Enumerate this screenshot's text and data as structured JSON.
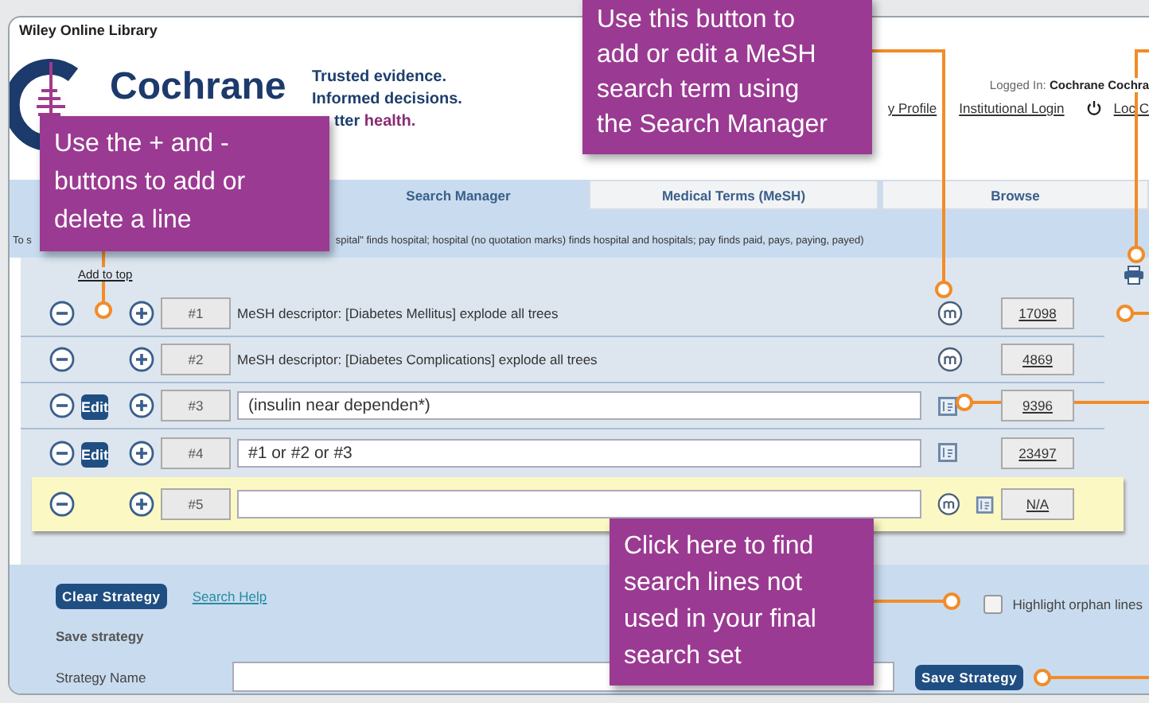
{
  "header": {
    "site_name": "Wiley Online Library",
    "logo_text": "Cochrane",
    "tagline": [
      "Trusted evidence.",
      "Informed decisions."
    ],
    "tagline_last": {
      "text": "tter",
      "accent": "health."
    },
    "logged_in": "Logged In: **Cochrane Cochra**",
    "links": [
      {
        "label": "y Profile",
        "kind": "link"
      },
      {
        "label": "Institutional Login",
        "kind": "link"
      },
      {
        "label": "Loc C",
        "kind": "logout"
      }
    ]
  },
  "tabs": [
    {
      "label": "Search Manager",
      "selected": true
    },
    {
      "label": "Medical Terms (MeSH)",
      "selected": false
    },
    {
      "label": "Browse",
      "selected": false
    }
  ],
  "hint": {
    "start": "To s",
    "rest": "spital\" finds hospital; hospital (no quotation marks) finds hospital and hospitals; pay finds paid, pays, paying, payed)"
  },
  "add_to_top": "Add to top",
  "lines": [
    {
      "kind": "mesh",
      "number": "#1",
      "text": "MeSH descriptor: [Diabetes Mellitus] explode all trees",
      "count": "17098"
    },
    {
      "kind": "mesh",
      "number": "#2",
      "text": "MeSH descriptor: [Diabetes Complications] explode all trees",
      "count": "4869"
    },
    {
      "kind": "text",
      "edit": "Edit",
      "number": "#3",
      "value": "(insulin near dependen*)",
      "count": "9396"
    },
    {
      "kind": "text",
      "edit": "Edit",
      "number": "#4",
      "value": "#1 or #2 or #3",
      "count": "23497"
    },
    {
      "kind": "new",
      "number": "#5",
      "count": "N/A"
    }
  ],
  "clear_button": "Clear Strategy",
  "help_link": "Search Help",
  "orphan": {
    "label": "Highlight orphan lines",
    "checked": false
  },
  "save": {
    "heading": "Save strategy",
    "name_label": "Strategy Name",
    "button": "Save Strategy"
  },
  "callouts": [
    {
      "lines": [
        "Use the + and -",
        "buttons to add or",
        "delete a line"
      ]
    },
    {
      "lines": [
        "Use this button to",
        "add or edit a MeSH",
        "search term using",
        "the Search Manager"
      ]
    },
    {
      "lines": [
        "Click here to find",
        "search lines not",
        "used in your final",
        "search set"
      ]
    }
  ]
}
